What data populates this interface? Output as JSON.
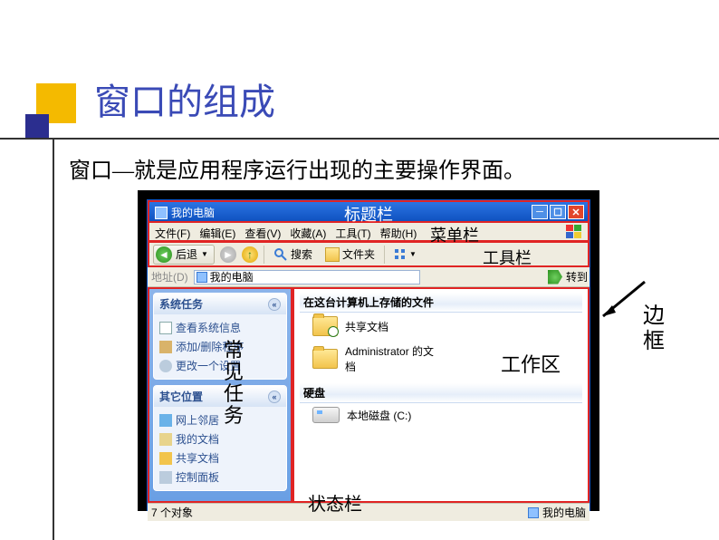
{
  "slide": {
    "title": "窗口的组成",
    "subtitle": "窗口—就是应用程序运行出现的主要操作界面。"
  },
  "window": {
    "title": "我的电脑",
    "menus": [
      "文件(F)",
      "编辑(E)",
      "查看(V)",
      "收藏(A)",
      "工具(T)",
      "帮助(H)"
    ],
    "toolbar": {
      "back": "后退",
      "search": "搜索",
      "folders": "文件夹"
    },
    "address": {
      "label": "地址(D)",
      "value": "我的电脑",
      "go": "转到"
    },
    "side_panels": {
      "system": {
        "title": "系统任务",
        "links": [
          "查看系统信息",
          "添加/删除程序",
          "更改一个设置"
        ]
      },
      "other": {
        "title": "其它位置",
        "links": [
          "网上邻居",
          "我的文档",
          "共享文档",
          "控制面板"
        ]
      }
    },
    "work": {
      "section1": "在这台计算机上存储的文件",
      "items1": [
        "共享文档",
        "Administrator 的文档"
      ],
      "section2": "硬盘",
      "drive": "本地磁盘 (C:)"
    },
    "status": {
      "count": "7 个对象",
      "loc": "我的电脑"
    }
  },
  "labels": {
    "titlebar": "标题栏",
    "menubar": "菜单栏",
    "toolbar": "工具栏",
    "taskpane": "常见任务",
    "workarea": "工作区",
    "statusbar": "状态栏",
    "border": "边框"
  }
}
